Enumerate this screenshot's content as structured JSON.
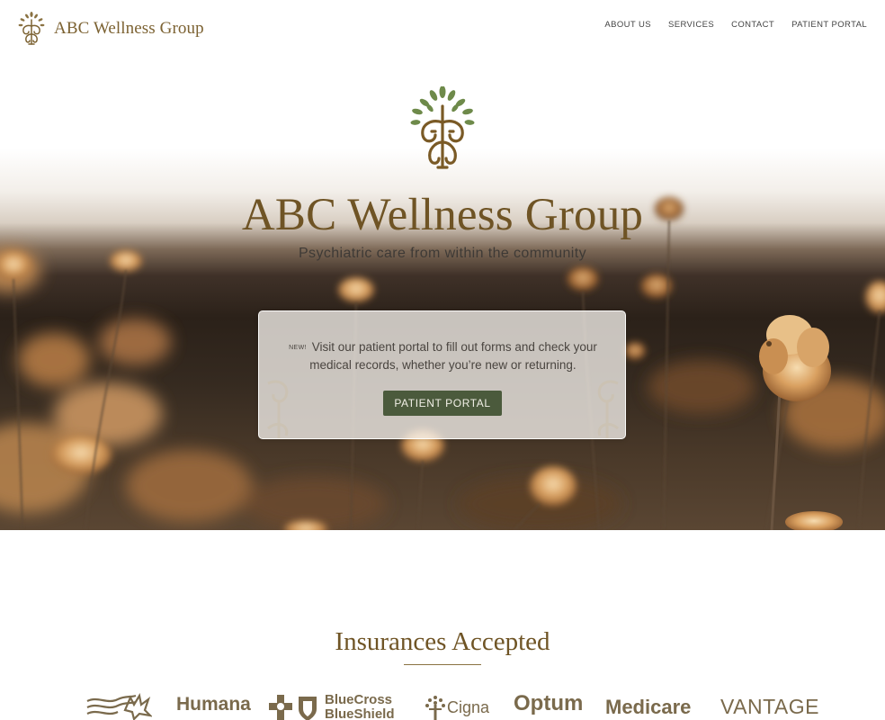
{
  "header": {
    "brand_name": "ABC Wellness Group",
    "brand_logo_icon": "tree-monogram-icon",
    "nav": [
      "ABOUT US",
      "SERVICES",
      "CONTACT",
      "PATIENT PORTAL"
    ]
  },
  "hero": {
    "logo_icon": "leafy-monogram-icon",
    "title": "ABC Wellness Group",
    "tagline": "Psychiatric care from within the community",
    "notice": {
      "badge": "NEW!",
      "text": "Visit our patient portal to fill out forms and check your medical records, whether you’re new or returning.",
      "button_label": "PATIENT PORTAL"
    }
  },
  "insurances": {
    "title": "Insurances Accepted",
    "logos": [
      "Humana",
      "BlueCross",
      "BlueShield",
      "Cigna",
      "Optum",
      "Medicare",
      "VANTAGE"
    ]
  },
  "colors": {
    "brand_gold": "#7c6232",
    "title_brown": "#6f5425",
    "leaf_green": "#6e8a4a",
    "button_green": "#4b5a3c",
    "text_dark": "#3e3a36"
  }
}
